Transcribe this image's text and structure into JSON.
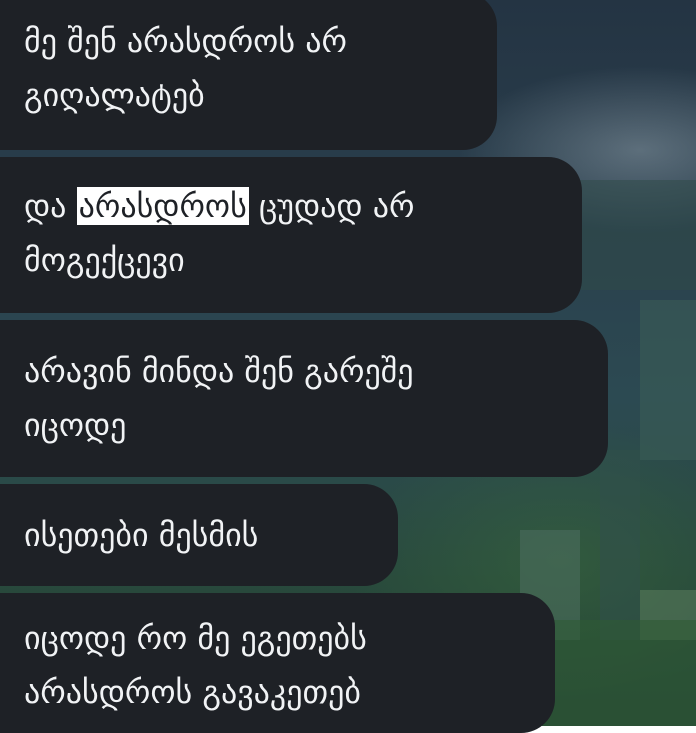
{
  "messages": [
    {
      "lines": [
        "მე შენ არასდროს არ",
        "გიღალატებ"
      ]
    },
    {
      "line1_before": "და",
      "line1_highlight": "არასდროს",
      "line1_after": "ცუდად არ",
      "line2": "მოგექცევი"
    },
    {
      "lines": [
        "არავინ მინდა შენ გარეშე",
        "იცოდე"
      ]
    },
    {
      "lines": [
        "ისეთები მესმის"
      ]
    },
    {
      "lines": [
        "იცოდე რო მე ეგეთებს",
        "არასდროს გავაკეთებ"
      ]
    }
  ],
  "colors": {
    "bubble_bg": "#1e2126",
    "bubble_text": "#f1f3f5",
    "highlight_bg": "#ffffff"
  }
}
